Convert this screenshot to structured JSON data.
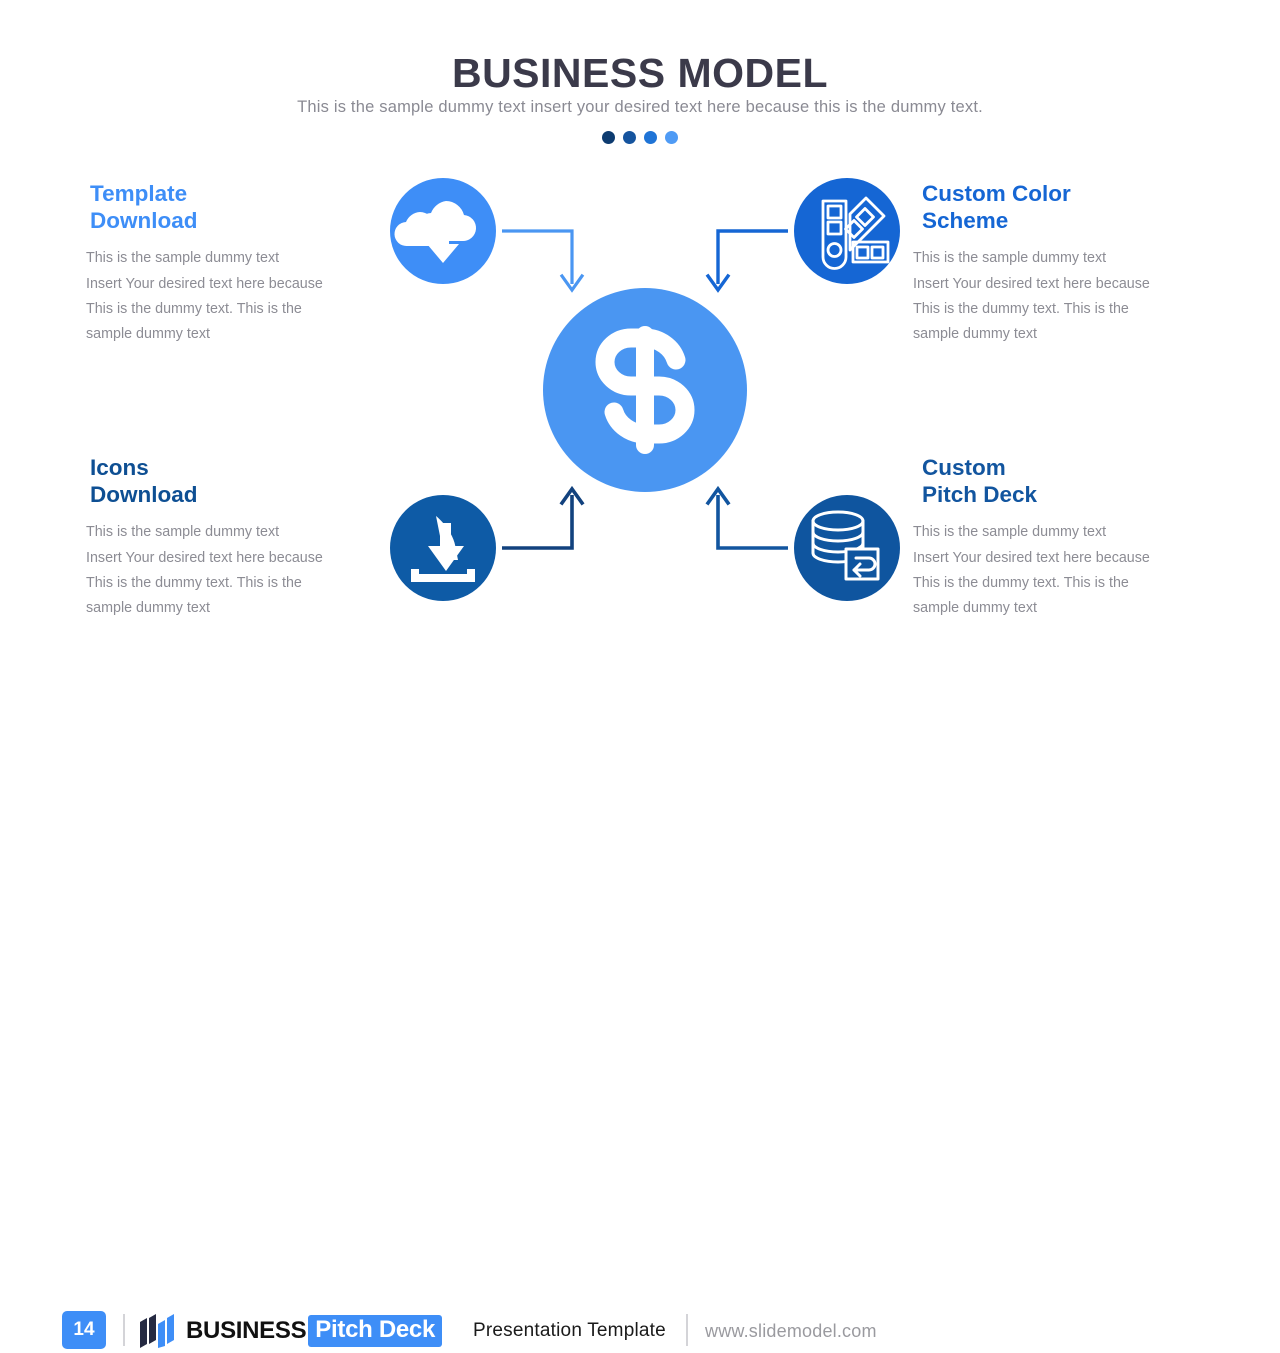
{
  "header": {
    "title": "BUSINESS MODEL",
    "subtitle": "This is the sample dummy text insert your desired text here because this is the dummy text.",
    "dots": [
      {
        "name": "dot-1",
        "color": "#0d3b70"
      },
      {
        "name": "dot-2",
        "color": "#15549e"
      },
      {
        "name": "dot-3",
        "color": "#1f74d6"
      },
      {
        "name": "dot-4",
        "color": "#4f9bf5"
      }
    ]
  },
  "center": {
    "icon": "dollar-sign-icon",
    "symbol": "$",
    "color": "#4a96f2"
  },
  "features": [
    {
      "id": "template-download",
      "heading": "Template\nDownload",
      "heading_color": "#3e8ef7",
      "body": "This is the sample dummy text\nInsert Your desired text here because\nThis is the dummy text. This is the\nsample dummy text",
      "icon": "cloud-download-icon",
      "circle_color": "#3e8ef7",
      "connector_color": "#4a96f2",
      "position": "top-left"
    },
    {
      "id": "custom-color-scheme",
      "heading": "Custom Color\nScheme",
      "heading_color": "#1566d4",
      "body": "This is the sample dummy text\nInsert Your desired text here because\nThis is the dummy text. This is the\nsample dummy text",
      "icon": "color-palette-swatch-icon",
      "circle_color": "#1566d4",
      "connector_color": "#1566d4",
      "position": "top-right"
    },
    {
      "id": "icons-download",
      "heading": "Icons\nDownload",
      "heading_color": "#0e4f93",
      "body": "This is the sample dummy text\nInsert Your desired text here because\nThis is the dummy text. This is the\nsample dummy text",
      "icon": "download-tray-icon",
      "circle_color": "#0e5ba6",
      "connector_color": "#12427e",
      "position": "bottom-left"
    },
    {
      "id": "custom-pitch-deck",
      "heading": "Custom\nPitch Deck",
      "heading_color": "#12559f",
      "body": "This is the sample dummy text\nInsert Your desired text here because\nThis is the dummy text. This is the\nsample dummy text",
      "icon": "database-restore-icon",
      "circle_color": "#0f559f",
      "connector_color": "#12559f",
      "position": "bottom-right"
    }
  ],
  "footer": {
    "page_number": "14",
    "logo": "business-pitch-deck-logo",
    "brand_first": "BUSINESS",
    "brand_second": "Pitch Deck",
    "tagline": "Presentation Template",
    "url": "www.slidemodel.com"
  }
}
